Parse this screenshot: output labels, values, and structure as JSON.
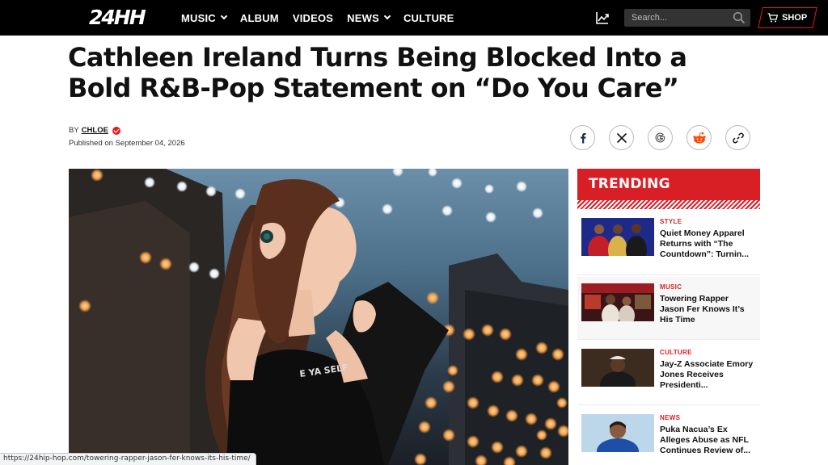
{
  "nav": {
    "logo": "24HH",
    "links": [
      {
        "label": "MUSIC",
        "has_dropdown": true
      },
      {
        "label": "ALBUM",
        "has_dropdown": false
      },
      {
        "label": "VIDEOS",
        "has_dropdown": false
      },
      {
        "label": "NEWS",
        "has_dropdown": true
      },
      {
        "label": "CULTURE",
        "has_dropdown": false
      }
    ],
    "search_placeholder": "Search...",
    "shop_label": "SHOP",
    "icons": [
      "trending-chart-icon",
      "search-icon",
      "cart-icon"
    ]
  },
  "article": {
    "headline_line1": "Cathleen Ireland Turns Being Blocked Into a",
    "headline_line2": "Bold R&B-Pop Statement on “Do You Care”",
    "by_prefix": "BY",
    "author": "CHLOE",
    "published": "Published on September 04, 2026",
    "share_icons": [
      "facebook-icon",
      "x-icon",
      "google-icon",
      "reddit-icon",
      "link-icon"
    ],
    "hero_shirt_text": "E YA SELF"
  },
  "trending": {
    "title": "TRENDING",
    "items": [
      {
        "category": "STYLE",
        "title": "Quiet Money Apparel Returns with “The Countdown”: Turnin..."
      },
      {
        "category": "MUSIC",
        "title": "Towering Rapper Jason Fer Knows It’s His Time"
      },
      {
        "category": "CULTURE",
        "title": "Jay-Z Associate Emory Jones Receives Presidenti..."
      },
      {
        "category": "NEWS",
        "title": "Puka Nacua’s Ex Alleges Abuse as NFL Continues Review of..."
      }
    ]
  },
  "status_bar": {
    "url": "https://24hip-hop.com/towering-rapper-jason-fer-knows-its-his-time/"
  },
  "colors": {
    "accent": "#d91f26",
    "nav_bg": "#000000"
  }
}
